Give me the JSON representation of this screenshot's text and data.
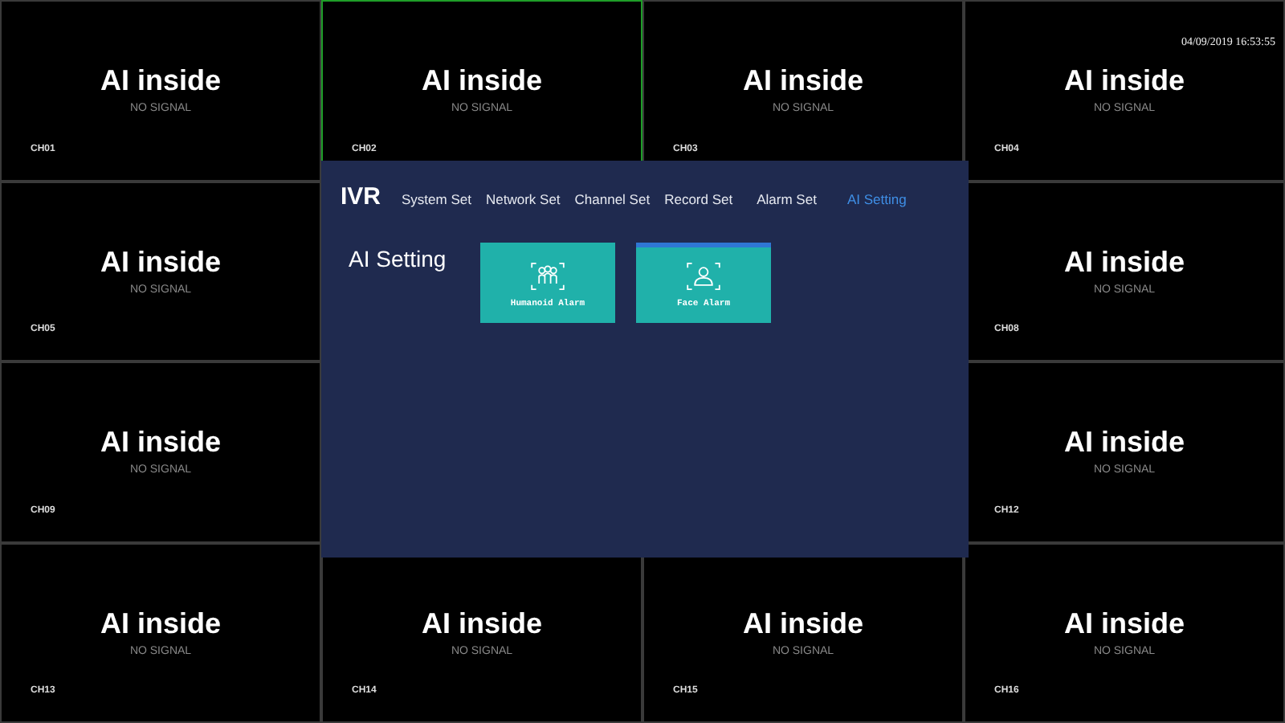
{
  "clock": "04/09/2019 16:53:55",
  "channels": [
    {
      "title": "AI inside",
      "status": "NO SIGNAL",
      "label": "CH01",
      "selected": false
    },
    {
      "title": "AI inside",
      "status": "NO SIGNAL",
      "label": "CH02",
      "selected": true
    },
    {
      "title": "AI inside",
      "status": "NO SIGNAL",
      "label": "CH03",
      "selected": false
    },
    {
      "title": "AI inside",
      "status": "NO SIGNAL",
      "label": "CH04",
      "selected": false
    },
    {
      "title": "AI inside",
      "status": "NO SIGNAL",
      "label": "CH05",
      "selected": false
    },
    {
      "title": "AI inside",
      "status": "NO SIGNAL",
      "label": "CH08",
      "selected": false
    },
    {
      "title": "AI inside",
      "status": "NO SIGNAL",
      "label": "CH09",
      "selected": false
    },
    {
      "title": "AI inside",
      "status": "NO SIGNAL",
      "label": "CH12",
      "selected": false
    },
    {
      "title": "AI inside",
      "status": "NO SIGNAL",
      "label": "CH13",
      "selected": false
    },
    {
      "title": "AI inside",
      "status": "NO SIGNAL",
      "label": "CH14",
      "selected": false
    },
    {
      "title": "AI inside",
      "status": "NO SIGNAL",
      "label": "CH15",
      "selected": false
    },
    {
      "title": "AI inside",
      "status": "NO SIGNAL",
      "label": "CH16",
      "selected": false
    }
  ],
  "dialog": {
    "brand": "IVR",
    "tabs": [
      {
        "label": "System Set",
        "selected": false
      },
      {
        "label": "Network Set",
        "selected": false
      },
      {
        "label": "Channel Set",
        "selected": false
      },
      {
        "label": "Record Set",
        "selected": false
      },
      {
        "label": "Alarm Set",
        "selected": false
      },
      {
        "label": "AI Setting",
        "selected": true
      }
    ],
    "section_title": "AI Setting",
    "buttons": [
      {
        "label": "Humanoid Alarm",
        "kind": "group",
        "selected": false
      },
      {
        "label": "Face Alarm",
        "kind": "face",
        "selected": true
      }
    ]
  }
}
